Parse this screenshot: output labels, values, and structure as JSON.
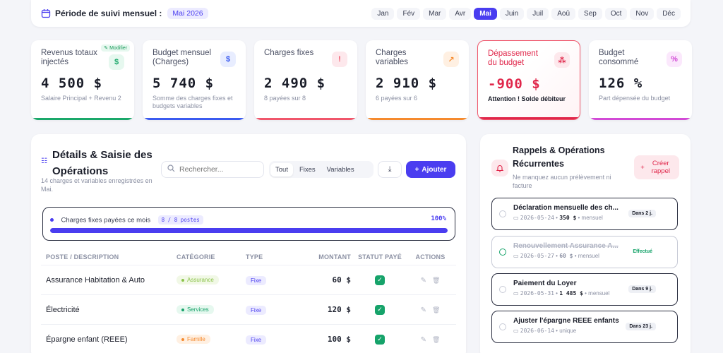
{
  "period": {
    "label": "Période de suivi mensuel :",
    "current": "Mai 2026",
    "months": [
      "Jan",
      "Fév",
      "Mar",
      "Avr",
      "Mai",
      "Juin",
      "Juil",
      "Aoû",
      "Sep",
      "Oct",
      "Nov",
      "Déc"
    ],
    "active_month": "Mai"
  },
  "kpis": [
    {
      "title": "Revenus totaux injectés",
      "value": "4 500 $",
      "sub": "Salaire Principal + Revenu 2",
      "icon": "dollar-icon",
      "icon_char": "$",
      "color": "#1aa86a",
      "icon_bg": "#e6f8ef",
      "edit_label": "✎ Modifier"
    },
    {
      "title": "Budget mensuel (Charges)",
      "value": "5 740 $",
      "sub": "Somme des charges fixes et budgets variables",
      "icon": "dollar-icon",
      "icon_char": "$",
      "color": "#3b5bf0",
      "icon_bg": "#e8edff"
    },
    {
      "title": "Charges fixes",
      "value": "2 490 $",
      "sub": "8 payées sur 8",
      "icon": "alert-circle-icon",
      "icon_char": "!",
      "color": "#f0566b",
      "icon_bg": "#fde8ec"
    },
    {
      "title": "Charges variables",
      "value": "2 910 $",
      "sub": "6 payées sur 6",
      "icon": "trend-icon",
      "icon_char": "↗",
      "color": "#f58a2e",
      "icon_bg": "#fff0e2"
    },
    {
      "title": "Dépassement du budget",
      "value": "-900 $",
      "sub": "Attention ! Solde débiteur",
      "icon": "scatter-icon",
      "icon_char": "⁂",
      "color": "#e0264a",
      "icon_bg": "#fde8ec"
    },
    {
      "title": "Budget consommé",
      "value": "126 %",
      "sub": "Part dépensée du budget",
      "icon": "percent-icon",
      "icon_char": "%",
      "color": "#d24ad6",
      "icon_bg": "#fbe8fc"
    }
  ],
  "operations": {
    "title": "Détails & Saisie des Opérations",
    "subtitle": "14 charges et variables enregistrées en Mai.",
    "search_placeholder": "Rechercher...",
    "filters": [
      "Tout",
      "Fixes",
      "Variables"
    ],
    "active_filter": "Tout",
    "add_label": "Ajouter",
    "progress": {
      "label": "Charges fixes payées ce mois",
      "count": "8 / 8 postes",
      "percent_label": "100%",
      "fraction": 1.0
    },
    "columns": [
      "POSTE / DESCRIPTION",
      "CATÉGORIE",
      "TYPE",
      "MONTANT",
      "STATUT PAYÉ",
      "ACTIONS"
    ],
    "rows": [
      {
        "name": "Assurance Habitation & Auto",
        "category": "Assurance",
        "cat_color": "#8bc34a",
        "cat_bg": "#f1f8e6",
        "type": "Fixe",
        "amount": "60 $"
      },
      {
        "name": "Électricité",
        "category": "Services",
        "cat_color": "#16a36a",
        "cat_bg": "#e6f8ef",
        "type": "Fixe",
        "amount": "120 $"
      },
      {
        "name": "Épargne enfant (REEE)",
        "category": "Famille",
        "cat_color": "#f58a2e",
        "cat_bg": "#fff0e2",
        "type": "Fixe",
        "amount": "100 $"
      }
    ]
  },
  "reminders": {
    "title": "Rappels & Opérations Récurrentes",
    "subtitle": "Ne manquez aucun prélèvement ni facture",
    "create_label": "Créer rappel",
    "items": [
      {
        "title": "Déclaration mensuelle des ch...",
        "date": "2026-05-24",
        "amount": "350 $",
        "freq": "mensuel",
        "badge": "Dans 2 j.",
        "done": false
      },
      {
        "title": "Renouvellement Assurance A...",
        "date": "2026-05-27",
        "amount": "60 $",
        "freq": "mensuel",
        "badge": "Effectué",
        "done": true
      },
      {
        "title": "Paiement du Loyer",
        "date": "2026-05-31",
        "amount": "1 485 $",
        "freq": "mensuel",
        "badge": "Dans 9 j.",
        "done": false
      },
      {
        "title": "Ajuster l'épargne REEE enfants",
        "date": "2026-06-14",
        "amount": "",
        "freq": "unique",
        "badge": "Dans 23 j.",
        "done": false
      }
    ]
  }
}
